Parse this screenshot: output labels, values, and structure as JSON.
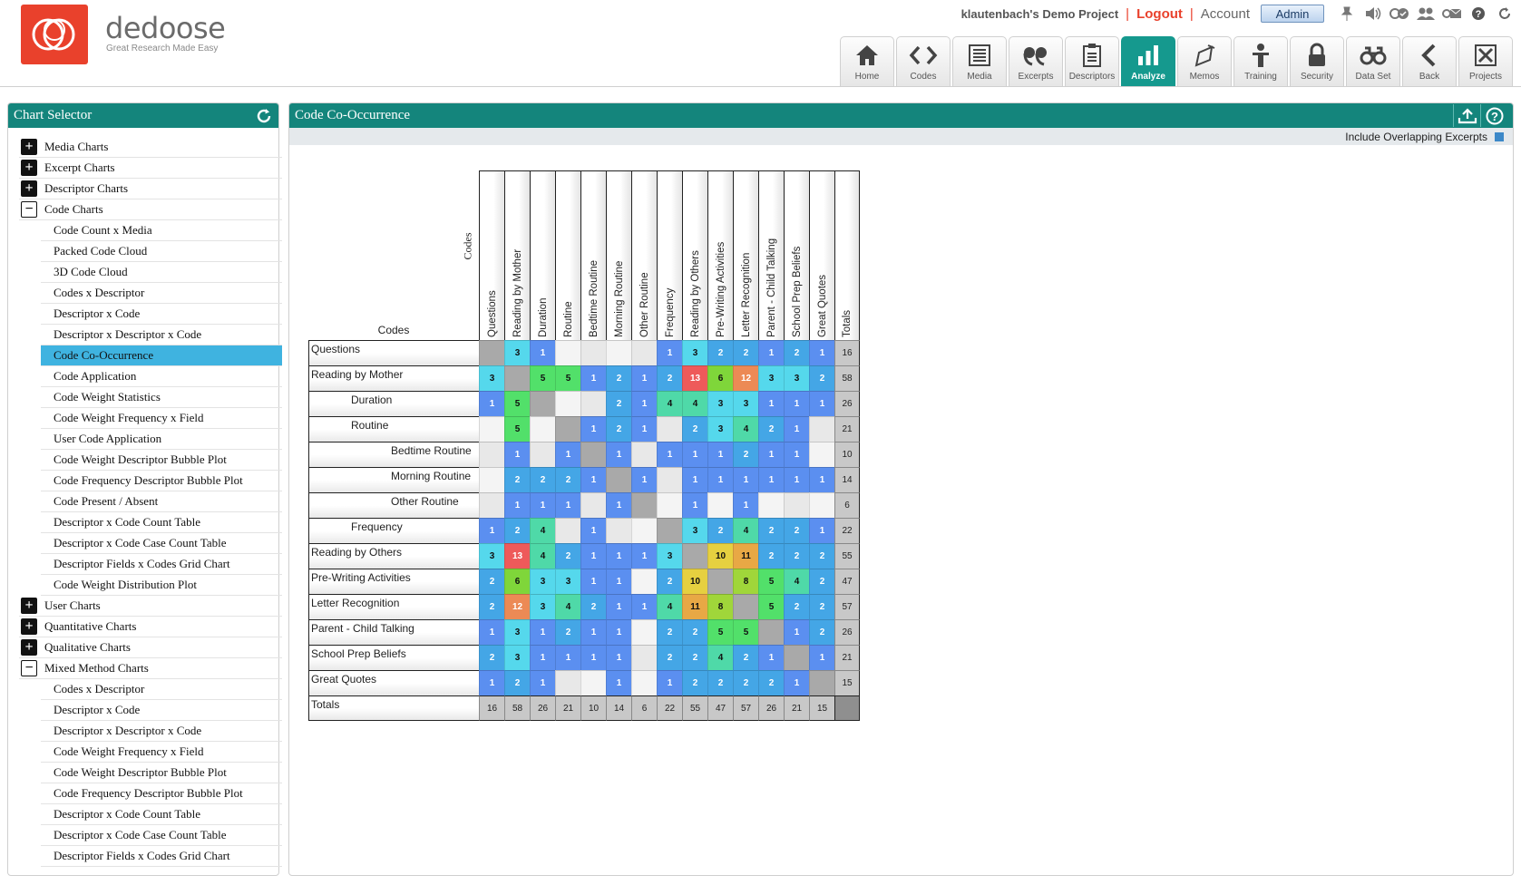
{
  "header": {
    "brand_name": "dedoose",
    "brand_tagline": "Great Research Made Easy",
    "project_name": "klautenbach's Demo Project",
    "separator": "|",
    "logout_label": "Logout",
    "account_label": "Account",
    "admin_label": "Admin"
  },
  "nav_tabs": [
    {
      "label": "Home",
      "icon": "home-icon"
    },
    {
      "label": "Codes",
      "icon": "code-brackets-icon"
    },
    {
      "label": "Media",
      "icon": "media-icon"
    },
    {
      "label": "Excerpts",
      "icon": "quote-icon"
    },
    {
      "label": "Descriptors",
      "icon": "clipboard-icon"
    },
    {
      "label": "Analyze",
      "icon": "bar-chart-icon"
    },
    {
      "label": "Memos",
      "icon": "memo-icon"
    },
    {
      "label": "Training",
      "icon": "person-icon"
    },
    {
      "label": "Security",
      "icon": "lock-icon"
    },
    {
      "label": "Data Set",
      "icon": "binoculars-icon"
    },
    {
      "label": "Back",
      "icon": "back-arrow-icon"
    },
    {
      "label": "Projects",
      "icon": "tools-icon"
    }
  ],
  "active_tab": "Analyze",
  "chart_selector": {
    "title": "Chart Selector",
    "sections": [
      {
        "label": "Media Charts",
        "expanded": false,
        "items": []
      },
      {
        "label": "Excerpt Charts",
        "expanded": false,
        "items": []
      },
      {
        "label": "Descriptor Charts",
        "expanded": false,
        "items": []
      },
      {
        "label": "Code Charts",
        "expanded": true,
        "items": [
          "Code Count x Media",
          "Packed Code Cloud",
          "3D Code Cloud",
          "Codes x Descriptor",
          "Descriptor x Code",
          "Descriptor x Descriptor x Code",
          "Code Co-Occurrence",
          "Code Application",
          "Code Weight Statistics",
          "Code Weight Frequency x Field",
          "User Code Application",
          "Code Weight Descriptor Bubble Plot",
          "Code Frequency Descriptor Bubble Plot",
          "Code Present / Absent",
          "Descriptor x Code Count Table",
          "Descriptor x Code Case Count Table",
          "Descriptor Fields x Codes Grid Chart",
          "Code Weight Distribution Plot"
        ]
      },
      {
        "label": "User Charts",
        "expanded": false,
        "items": []
      },
      {
        "label": "Quantitative Charts",
        "expanded": false,
        "items": []
      },
      {
        "label": "Qualitative Charts",
        "expanded": false,
        "items": []
      },
      {
        "label": "Mixed Method Charts",
        "expanded": true,
        "items": [
          "Codes x Descriptor",
          "Descriptor x Code",
          "Descriptor x Descriptor x Code",
          "Code Weight Frequency x Field",
          "Code Weight Descriptor Bubble Plot",
          "Code Frequency Descriptor Bubble Plot",
          "Descriptor x Code Count Table",
          "Descriptor x Code Case Count Table",
          "Descriptor Fields x Codes Grid Chart"
        ]
      }
    ],
    "selected": "Code Co-Occurrence"
  },
  "main": {
    "title": "Code Co-Occurrence",
    "overlap_label": "Include Overlapping Excerpts",
    "overlap_checked": true
  },
  "chart_data": {
    "type": "heatmap",
    "corner_label_top": "Codes",
    "corner_label_bottom": "Codes",
    "totals_label": "Totals",
    "codes": [
      {
        "name": "Questions",
        "level": 0
      },
      {
        "name": "Reading by Mother",
        "level": 0
      },
      {
        "name": "Duration",
        "level": 1
      },
      {
        "name": "Routine",
        "level": 1
      },
      {
        "name": "Bedtime Routine",
        "level": 2
      },
      {
        "name": "Morning Routine",
        "level": 2
      },
      {
        "name": "Other Routine",
        "level": 2
      },
      {
        "name": "Frequency",
        "level": 1
      },
      {
        "name": "Reading by Others",
        "level": 0
      },
      {
        "name": "Pre-Writing Activities",
        "level": 0
      },
      {
        "name": "Letter Recognition",
        "level": 0
      },
      {
        "name": "Parent - Child Talking",
        "level": 0
      },
      {
        "name": "School Prep Beliefs",
        "level": 0
      },
      {
        "name": "Great Quotes",
        "level": 0
      }
    ],
    "matrix": [
      [
        null,
        3,
        1,
        0,
        0,
        0,
        0,
        1,
        3,
        2,
        2,
        1,
        2,
        1
      ],
      [
        3,
        null,
        5,
        5,
        1,
        2,
        1,
        2,
        13,
        6,
        12,
        3,
        3,
        2
      ],
      [
        1,
        5,
        null,
        0,
        0,
        2,
        1,
        4,
        4,
        3,
        3,
        1,
        1,
        1
      ],
      [
        0,
        5,
        0,
        null,
        1,
        2,
        1,
        0,
        2,
        3,
        4,
        2,
        1,
        0
      ],
      [
        0,
        1,
        0,
        1,
        null,
        1,
        0,
        1,
        1,
        1,
        2,
        1,
        1,
        0
      ],
      [
        0,
        2,
        2,
        2,
        1,
        null,
        1,
        0,
        1,
        1,
        1,
        1,
        1,
        1
      ],
      [
        0,
        1,
        1,
        1,
        0,
        1,
        null,
        0,
        1,
        0,
        1,
        0,
        0,
        0
      ],
      [
        1,
        2,
        4,
        0,
        1,
        0,
        0,
        null,
        3,
        2,
        4,
        2,
        2,
        1
      ],
      [
        3,
        13,
        4,
        2,
        1,
        1,
        1,
        3,
        null,
        10,
        11,
        2,
        2,
        2
      ],
      [
        2,
        6,
        3,
        3,
        1,
        1,
        0,
        2,
        10,
        null,
        8,
        5,
        4,
        2
      ],
      [
        2,
        12,
        3,
        4,
        2,
        1,
        1,
        4,
        11,
        8,
        null,
        5,
        2,
        2
      ],
      [
        1,
        3,
        1,
        2,
        1,
        1,
        0,
        2,
        2,
        5,
        5,
        null,
        1,
        2
      ],
      [
        2,
        3,
        1,
        1,
        1,
        1,
        0,
        2,
        2,
        4,
        2,
        1,
        null,
        1
      ],
      [
        1,
        2,
        1,
        0,
        0,
        1,
        0,
        1,
        2,
        2,
        2,
        2,
        1,
        null
      ]
    ],
    "row_totals": [
      16,
      58,
      26,
      21,
      10,
      14,
      6,
      22,
      55,
      47,
      57,
      26,
      21,
      15
    ],
    "col_totals": [
      16,
      58,
      26,
      21,
      10,
      14,
      6,
      22,
      55,
      47,
      57,
      26,
      21,
      15
    ],
    "color_scale": {
      "1": "#5b8ff0",
      "2": "#44a6e6",
      "3": "#55d8ec",
      "4": "#4fd9a8",
      "5": "#52e06a",
      "6": "#7fd63a",
      "8": "#a0d63a",
      "10": "#e6d040",
      "11": "#e8a845",
      "12": "#ec8a55",
      "13": "#ee5a5a",
      "empty_odd": "#f4f4f4",
      "empty_even": "#e8e8e8",
      "diagonal": "#a9a9a9"
    }
  }
}
